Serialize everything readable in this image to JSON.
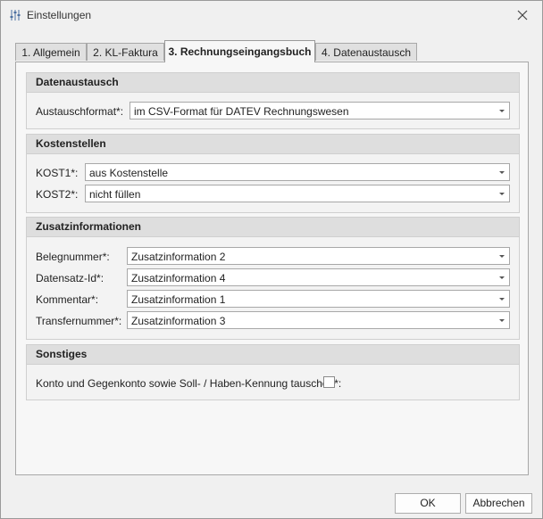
{
  "window": {
    "title": "Einstellungen",
    "icon": "sliders-icon"
  },
  "tabs": [
    {
      "label": "1. Allgemein",
      "active": false
    },
    {
      "label": "2. KL-Faktura",
      "active": false
    },
    {
      "label": "3. Rechnungseingangsbuch",
      "active": true
    },
    {
      "label": "4. Datenaustausch",
      "active": false
    }
  ],
  "sections": {
    "datenaustausch": {
      "title": "Datenaustausch",
      "austauschformat": {
        "label": "Austauschformat*:",
        "value": "im CSV-Format für DATEV Rechnungswesen"
      }
    },
    "kostenstellen": {
      "title": "Kostenstellen",
      "kost1": {
        "label": "KOST1*:",
        "value": "aus Kostenstelle"
      },
      "kost2": {
        "label": "KOST2*:",
        "value": "nicht füllen"
      }
    },
    "zusatzinformationen": {
      "title": "Zusatzinformationen",
      "belegnummer": {
        "label": "Belegnummer*:",
        "value": "Zusatzinformation 2"
      },
      "datensatz_id": {
        "label": "Datensatz-Id*:",
        "value": "Zusatzinformation 4"
      },
      "kommentar": {
        "label": "Kommentar*:",
        "value": "Zusatzinformation 1"
      },
      "transfernummer": {
        "label": "Transfernummer*:",
        "value": "Zusatzinformation 3"
      }
    },
    "sonstiges": {
      "title": "Sonstiges",
      "tauschen": {
        "label": "Konto und Gegenkonto sowie Soll- / Haben-Kennung tauschen*:",
        "checked": false
      }
    }
  },
  "buttons": {
    "ok": "OK",
    "cancel": "Abbrechen"
  }
}
